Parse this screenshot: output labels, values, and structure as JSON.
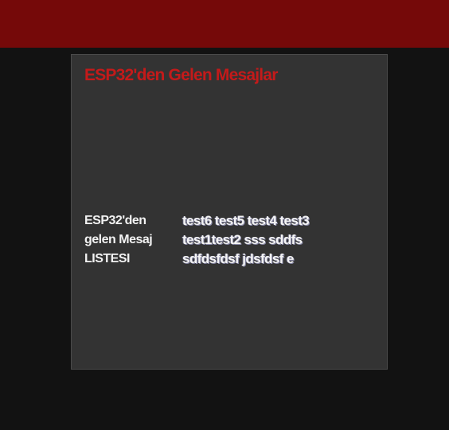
{
  "header": {
    "bar_color": "#750909"
  },
  "panel": {
    "title": "ESP32'den Gelen Mesajlar",
    "label": "ESP32'den gelen Mesaj LISTESI",
    "messages_text": "test6 test5 test4 test3 test1test2 sss sddfs sdfdsfdsf jdsfdsf e"
  },
  "colors": {
    "page_background": "#121212",
    "panel_background": "#333333",
    "title_color": "#c41a1a",
    "text_color": "#f2f2f2"
  }
}
